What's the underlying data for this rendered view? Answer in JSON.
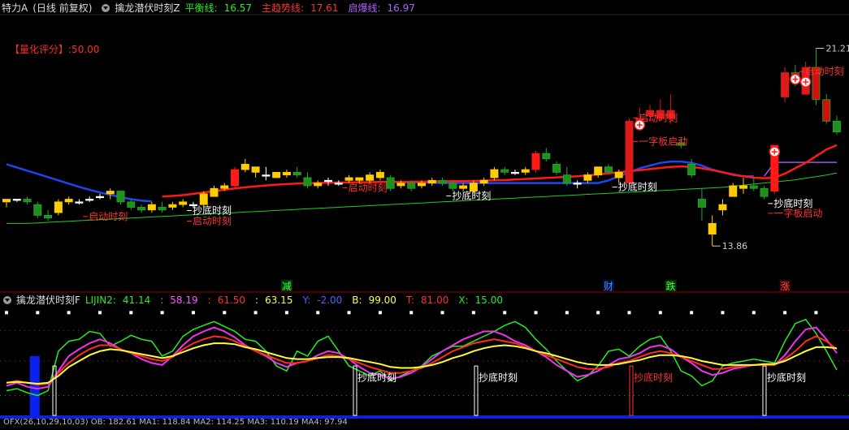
{
  "header": {
    "stock_name": "特力A",
    "stock_period": "(日线 前复权)",
    "indicator_name": "擒龙潜伏时刻Z",
    "items": [
      {
        "label": "平衡线:",
        "value": "16.57",
        "color": "#22ee22"
      },
      {
        "label": "主趋势线:",
        "value": "17.61",
        "color": "#ff3030"
      },
      {
        "label": "启爆线:",
        "value": "16.97",
        "color": "#b060ff"
      }
    ]
  },
  "score": {
    "label": "【量化评分】",
    "value": ":50.00"
  },
  "sub_header": {
    "indicator_name": "擒龙潜伏时刻F",
    "items": [
      {
        "label": "LIJIN2:",
        "value": "41.14",
        "color": "#22ee22"
      },
      {
        "label": ":",
        "value": "58.19",
        "color": "#ff55ff"
      },
      {
        "label": ":",
        "value": "61.50",
        "color": "#ff3030"
      },
      {
        "label": ":",
        "value": "63.15",
        "color": "#ffff44"
      },
      {
        "label": "Y:",
        "value": "-2.00",
        "color": "#4466ff"
      },
      {
        "label": "B:",
        "value": "99.00",
        "color": "#ffff44"
      },
      {
        "label": "T:",
        "value": "81.00",
        "color": "#ff3030"
      },
      {
        "label": "X:",
        "value": "15.00",
        "color": "#22ee22"
      }
    ]
  },
  "bottom_strip": {
    "text": "OFX(26,10,29,10,03)  OB: 182.61  MA1: 118.84  MA2: 114.25  MA3: 110.19  MA4: 97.94"
  },
  "chart_data": {
    "type": "candlestick",
    "y_range": [
      12.6,
      22.4
    ],
    "high_label": "21.21",
    "low_label": "13.86",
    "candles": [
      [
        15.5,
        15.6,
        15.3,
        15.6
      ],
      [
        15.6,
        15.6,
        15.5,
        15.6
      ],
      [
        15.6,
        15.7,
        15.4,
        15.5
      ],
      [
        15.4,
        15.5,
        14.9,
        15.0
      ],
      [
        15.0,
        15.2,
        14.8,
        14.9
      ],
      [
        15.1,
        15.6,
        15.0,
        15.5
      ],
      [
        15.5,
        15.7,
        15.4,
        15.6
      ],
      [
        15.5,
        15.6,
        15.4,
        15.5
      ],
      [
        15.6,
        15.7,
        15.5,
        15.6
      ],
      [
        15.7,
        15.8,
        15.6,
        15.7
      ],
      [
        15.8,
        16.0,
        15.6,
        15.9
      ],
      [
        15.9,
        15.9,
        15.4,
        15.5
      ],
      [
        15.5,
        15.6,
        15.2,
        15.3
      ],
      [
        15.3,
        15.4,
        15.1,
        15.2
      ],
      [
        15.2,
        15.5,
        15.1,
        15.4
      ],
      [
        15.3,
        15.5,
        15.1,
        15.2
      ],
      [
        15.3,
        15.5,
        15.2,
        15.4
      ],
      [
        15.4,
        15.6,
        15.3,
        15.5
      ],
      [
        15.4,
        15.5,
        15.3,
        15.4
      ],
      [
        15.4,
        15.9,
        15.3,
        15.8
      ],
      [
        15.7,
        16.1,
        15.7,
        16.0
      ],
      [
        16.0,
        16.2,
        15.9,
        16.1
      ],
      [
        16.1,
        16.8,
        16.0,
        16.7
      ],
      [
        16.7,
        17.1,
        16.6,
        16.9
      ],
      [
        16.6,
        16.8,
        16.4,
        16.8
      ],
      [
        16.5,
        16.8,
        16.3,
        16.5
      ],
      [
        16.4,
        16.6,
        16.4,
        16.6
      ],
      [
        16.5,
        16.7,
        16.4,
        16.6
      ],
      [
        16.6,
        16.8,
        16.4,
        16.5
      ],
      [
        16.4,
        16.6,
        16.0,
        16.1
      ],
      [
        16.1,
        16.3,
        16.0,
        16.2
      ],
      [
        16.3,
        16.4,
        16.1,
        16.3
      ],
      [
        16.2,
        16.3,
        16.1,
        16.2
      ],
      [
        16.3,
        16.5,
        16.2,
        16.4
      ],
      [
        16.3,
        16.4,
        16.2,
        16.4
      ],
      [
        16.3,
        16.6,
        16.2,
        16.5
      ],
      [
        16.4,
        16.7,
        16.3,
        16.6
      ],
      [
        16.4,
        16.5,
        15.9,
        16.0
      ],
      [
        16.1,
        16.3,
        16.0,
        16.2
      ],
      [
        16.2,
        16.3,
        15.9,
        16.0
      ],
      [
        16.1,
        16.3,
        16.0,
        16.2
      ],
      [
        16.2,
        16.4,
        16.1,
        16.3
      ],
      [
        16.3,
        16.4,
        16.1,
        16.2
      ],
      [
        16.2,
        16.3,
        15.9,
        16.0
      ],
      [
        16.0,
        16.2,
        15.9,
        16.1
      ],
      [
        15.9,
        16.3,
        15.8,
        16.2
      ],
      [
        16.2,
        16.4,
        16.1,
        16.3
      ],
      [
        16.4,
        16.8,
        16.3,
        16.7
      ],
      [
        16.7,
        16.8,
        16.5,
        16.6
      ],
      [
        16.6,
        16.7,
        16.5,
        16.6
      ],
      [
        16.6,
        16.8,
        16.5,
        16.7
      ],
      [
        16.7,
        17.4,
        16.6,
        17.3
      ],
      [
        17.3,
        17.5,
        17.0,
        17.1
      ],
      [
        16.9,
        17.0,
        16.5,
        16.6
      ],
      [
        16.5,
        16.8,
        16.1,
        16.2
      ],
      [
        16.2,
        16.3,
        16.0,
        16.2
      ],
      [
        16.3,
        16.6,
        16.2,
        16.5
      ],
      [
        16.5,
        16.8,
        16.4,
        16.8
      ],
      [
        16.8,
        16.9,
        16.6,
        16.6
      ],
      [
        16.4,
        16.7,
        16.2,
        16.6
      ],
      [
        16.2,
        18.6,
        16.2,
        18.5
      ],
      [
        18.5,
        19.0,
        18.2,
        18.6
      ],
      [
        18.7,
        19.1,
        18.5,
        18.9
      ],
      [
        18.6,
        19.3,
        18.5,
        18.9
      ],
      [
        18.6,
        19.5,
        18.4,
        18.9
      ],
      [
        17.7,
        17.9,
        17.5,
        17.6
      ],
      [
        16.9,
        17.1,
        16.4,
        16.5
      ],
      [
        15.6,
        16.0,
        14.8,
        15.3
      ],
      [
        14.3,
        15.0,
        13.86,
        14.7
      ],
      [
        15.2,
        15.6,
        15.0,
        15.4
      ],
      [
        15.7,
        16.2,
        15.7,
        16.1
      ],
      [
        16.0,
        16.4,
        15.8,
        16.1
      ],
      [
        16.1,
        16.4,
        15.9,
        16.0
      ],
      [
        16.0,
        16.1,
        15.6,
        15.7
      ],
      [
        15.9,
        17.6,
        15.8,
        17.6
      ],
      [
        19.4,
        20.5,
        19.2,
        20.3
      ],
      [
        20.3,
        20.6,
        19.8,
        20.1
      ],
      [
        19.5,
        20.7,
        19.5,
        20.5
      ],
      [
        20.5,
        21.21,
        19.1,
        19.3
      ],
      [
        19.3,
        19.5,
        18.4,
        18.5
      ],
      [
        18.5,
        18.7,
        18.0,
        18.1
      ]
    ],
    "balance_line": [
      14.7,
      14.7,
      14.7,
      14.72,
      14.74,
      14.76,
      14.78,
      14.8,
      14.82,
      14.84,
      14.86,
      14.88,
      14.9,
      14.92,
      14.94,
      14.96,
      14.98,
      15.0,
      15.02,
      15.04,
      15.06,
      15.08,
      15.1,
      15.12,
      15.14,
      15.16,
      15.18,
      15.2,
      15.22,
      15.24,
      15.26,
      15.28,
      15.3,
      15.32,
      15.34,
      15.36,
      15.38,
      15.4,
      15.42,
      15.44,
      15.46,
      15.48,
      15.5,
      15.52,
      15.54,
      15.56,
      15.58,
      15.6,
      15.62,
      15.64,
      15.66,
      15.68,
      15.7,
      15.72,
      15.74,
      15.76,
      15.78,
      15.8,
      15.82,
      15.84,
      15.86,
      15.88,
      15.9,
      15.92,
      15.94,
      15.96,
      15.98,
      16.0,
      16.02,
      16.04,
      16.08,
      16.12,
      16.16,
      16.2,
      16.24,
      16.28,
      16.32,
      16.38,
      16.44,
      16.5,
      16.57
    ],
    "main_trend_line": [
      null,
      null,
      null,
      null,
      null,
      null,
      null,
      null,
      null,
      null,
      null,
      null,
      null,
      null,
      null,
      15.7,
      15.72,
      15.75,
      15.8,
      15.85,
      15.9,
      15.95,
      16.0,
      16.04,
      16.08,
      16.11,
      16.14,
      16.16,
      16.18,
      16.19,
      16.2,
      16.21,
      16.22,
      16.22,
      16.23,
      16.23,
      16.24,
      16.24,
      16.24,
      16.25,
      16.25,
      16.26,
      16.26,
      16.27,
      16.27,
      16.28,
      16.29,
      16.3,
      16.31,
      16.33,
      16.35,
      16.37,
      16.39,
      16.41,
      16.43,
      16.45,
      16.48,
      16.52,
      16.56,
      16.6,
      16.64,
      16.68,
      16.72,
      16.76,
      16.8,
      16.82,
      16.8,
      16.75,
      16.68,
      16.6,
      16.52,
      16.45,
      16.4,
      16.38,
      16.4,
      16.55,
      16.75,
      16.95,
      17.2,
      17.45,
      17.61
    ],
    "breakout_line": [
      16.9,
      16.78,
      16.66,
      16.54,
      16.42,
      16.3,
      16.18,
      16.06,
      15.95,
      15.85,
      15.76,
      15.68,
      15.6,
      15.55,
      15.52,
      null,
      null,
      null,
      null,
      null,
      null,
      null,
      null,
      null,
      null,
      null,
      null,
      null,
      null,
      null,
      null,
      null,
      null,
      null,
      null,
      null,
      null,
      16.25,
      16.24,
      16.23,
      16.22,
      16.21,
      16.2,
      16.2,
      16.2,
      16.2,
      16.2,
      16.2,
      16.2,
      16.2,
      16.2,
      16.2,
      16.2,
      16.2,
      16.2,
      16.2,
      16.2,
      16.2,
      16.3,
      16.45,
      16.6,
      16.75,
      16.85,
      16.95,
      17.0,
      17.0,
      16.95,
      16.85,
      16.7,
      16.6,
      16.5,
      16.45,
      16.45,
      16.45,
      16.97,
      16.97,
      16.97,
      16.97,
      16.97,
      16.97,
      16.97
    ],
    "breakout_line_colors": {
      "blue_segments": [
        [
          0,
          14
        ],
        [
          37,
          72
        ]
      ],
      "purple_segment": [
        73,
        80
      ]
    },
    "annotations": [
      {
        "i": 8,
        "text": "启动时刻",
        "color": "#ff3030",
        "offset": 10
      },
      {
        "i": 18,
        "text": "抄底时刻",
        "color": "#ffffff",
        "offset": -4
      },
      {
        "i": 18,
        "text": "启动时刻",
        "color": "#ff3030",
        "offset": 9
      },
      {
        "i": 33,
        "text": "启动时刻",
        "color": "#ff3030",
        "offset": -2
      },
      {
        "i": 43,
        "text": "抄底时刻",
        "color": "#ffffff",
        "offset": -2
      },
      {
        "i": 59,
        "text": "抄底时刻",
        "color": "#ffffff",
        "offset": -3
      },
      {
        "i": 61,
        "text": "启动时刻",
        "color": "#ff3030",
        "offset": -22
      },
      {
        "i": 61,
        "text": "一字板启动",
        "color": "#ff3030",
        "offset": 7
      },
      {
        "i": 74,
        "text": "抄底时刻",
        "color": "#ffffff",
        "offset": 4
      },
      {
        "i": 74,
        "text": "一字板启动",
        "color": "#ff3030",
        "offset": 16
      },
      {
        "i": 77,
        "text": "启动时刻",
        "color": "#ff3030",
        "offset": -36
      },
      {
        "i": 76,
        "text": "太爆涨",
        "color": "#aaaaaa",
        "offset": -130
      }
    ],
    "bottom_tags": [
      {
        "text": "减",
        "color": "#44ff44",
        "bg": "#003300",
        "i": 27
      },
      {
        "text": "财",
        "color": "#4488ff",
        "bg": "#001133",
        "i": 58
      },
      {
        "text": "跌",
        "color": "#44ff44",
        "bg": "#003300",
        "i": 64
      },
      {
        "text": "涨",
        "color": "#ff4444",
        "bg": "#330000",
        "i": 75
      }
    ],
    "oscillator": {
      "y_range": [
        -5,
        105
      ],
      "green": [
        20,
        22,
        18,
        15,
        20,
        60,
        70,
        72,
        80,
        78,
        65,
        70,
        76,
        72,
        70,
        55,
        60,
        75,
        82,
        86,
        90,
        85,
        80,
        72,
        70,
        60,
        45,
        40,
        60,
        55,
        70,
        75,
        60,
        45,
        40,
        35,
        40,
        30,
        35,
        40,
        45,
        55,
        60,
        65,
        65,
        70,
        75,
        80,
        86,
        90,
        84,
        72,
        62,
        50,
        40,
        30,
        35,
        45,
        60,
        62,
        55,
        65,
        72,
        75,
        60,
        40,
        35,
        25,
        30,
        45,
        48,
        50,
        52,
        50,
        48,
        70,
        88,
        92,
        78,
        60,
        41
      ],
      "magenta": [
        25,
        28,
        24,
        22,
        24,
        40,
        55,
        62,
        68,
        72,
        68,
        62,
        58,
        52,
        48,
        46,
        55,
        66,
        75,
        80,
        84,
        80,
        74,
        66,
        60,
        55,
        48,
        44,
        48,
        50,
        56,
        60,
        58,
        52,
        44,
        38,
        36,
        32,
        34,
        38,
        44,
        52,
        60,
        66,
        72,
        76,
        80,
        80,
        76,
        70,
        66,
        60,
        54,
        46,
        40,
        34,
        36,
        40,
        46,
        52,
        54,
        58,
        64,
        66,
        62,
        54,
        48,
        40,
        36,
        38,
        42,
        44,
        46,
        46,
        46,
        56,
        70,
        82,
        84,
        72,
        58
      ],
      "red": [
        28,
        30,
        28,
        26,
        27,
        38,
        48,
        56,
        62,
        66,
        66,
        62,
        58,
        55,
        52,
        50,
        54,
        62,
        68,
        72,
        75,
        74,
        70,
        65,
        60,
        56,
        52,
        48,
        48,
        50,
        53,
        56,
        55,
        52,
        48,
        44,
        41,
        38,
        38,
        40,
        43,
        48,
        54,
        60,
        64,
        68,
        70,
        72,
        70,
        68,
        64,
        60,
        56,
        52,
        48,
        44,
        42,
        42,
        44,
        48,
        50,
        54,
        58,
        60,
        58,
        54,
        50,
        46,
        42,
        42,
        44,
        45,
        46,
        46,
        46,
        52,
        60,
        70,
        75,
        70,
        62
      ],
      "yellow": [
        28,
        29,
        28,
        27,
        28,
        35,
        44,
        50,
        56,
        60,
        62,
        61,
        59,
        57,
        55,
        53,
        55,
        59,
        63,
        66,
        68,
        68,
        67,
        64,
        62,
        59,
        56,
        53,
        52,
        52,
        53,
        54,
        54,
        53,
        51,
        49,
        47,
        44,
        43,
        43,
        44,
        46,
        49,
        53,
        56,
        60,
        63,
        65,
        66,
        65,
        63,
        60,
        58,
        55,
        52,
        49,
        47,
        46,
        46,
        47,
        49,
        51,
        54,
        56,
        56,
        55,
        53,
        50,
        48,
        46,
        46,
        46,
        46,
        47,
        47,
        50,
        55,
        60,
        64,
        64,
        63
      ],
      "dots_levels": [
        99,
        81
      ],
      "green_dot_level": 15,
      "blue_bar_i": 1,
      "markers": [
        {
          "i": 3,
          "text": "",
          "color": "#ffffff"
        },
        {
          "i": 29,
          "text": "抄底时刻",
          "color": "#ffffff"
        },
        {
          "i": 39,
          "text": "抄底时刻",
          "color": "#ffffff"
        },
        {
          "i": 52,
          "text": "抄底时刻",
          "color": "#ff3030"
        },
        {
          "i": 63,
          "text": "抄底时刻",
          "color": "#ffffff"
        }
      ]
    }
  }
}
